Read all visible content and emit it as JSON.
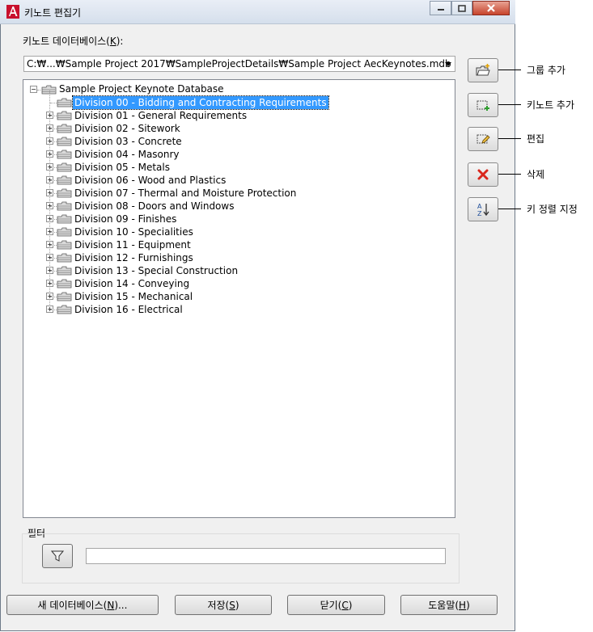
{
  "window": {
    "title": "키노트 편집기",
    "controls": {
      "minimize": "─",
      "maximize": "□",
      "close": "X"
    }
  },
  "database": {
    "label": "키노트 데이터베이스(",
    "label_key": "K",
    "label_end": "):",
    "path": "C:₩...₩Sample Project 2017₩SampleProjectDetails₩Sample Project AecKeynotes.mdb"
  },
  "tree": {
    "root": {
      "label": "Sample Project Keynote Database",
      "expander": "−"
    },
    "items": [
      {
        "label": "Division 00 - Bidding and Contracting Requirements",
        "selected": true,
        "has_children": false
      },
      {
        "label": "Division 01 - General Requirements",
        "has_children": true
      },
      {
        "label": "Division 02 - Sitework",
        "has_children": true
      },
      {
        "label": "Division 03 - Concrete",
        "has_children": true
      },
      {
        "label": "Division 04 - Masonry",
        "has_children": true
      },
      {
        "label": "Division 05 - Metals",
        "has_children": true
      },
      {
        "label": "Division 06 - Wood and Plastics",
        "has_children": true
      },
      {
        "label": "Division 07 - Thermal and Moisture Protection",
        "has_children": true
      },
      {
        "label": "Division 08 - Doors and Windows",
        "has_children": true
      },
      {
        "label": "Division 09 - Finishes",
        "has_children": true
      },
      {
        "label": "Division 10 - Specialities",
        "has_children": true
      },
      {
        "label": "Division 11 - Equipment",
        "has_children": true
      },
      {
        "label": "Division 12 - Furnishings",
        "has_children": true
      },
      {
        "label": "Division 13 - Special Construction",
        "has_children": true
      },
      {
        "label": "Division 14 - Conveying",
        "has_children": true
      },
      {
        "label": "Division 15 - Mechanical",
        "has_children": true
      },
      {
        "label": "Division 16 - Electrical",
        "has_children": true
      }
    ]
  },
  "side_buttons": [
    {
      "icon": "add-group-icon",
      "callout": "그룹 추가"
    },
    {
      "icon": "add-keynote-icon",
      "callout": "키노트 추가"
    },
    {
      "icon": "edit-icon",
      "callout": "편집"
    },
    {
      "icon": "delete-icon",
      "callout": "삭제"
    },
    {
      "icon": "sort-icon",
      "callout": "키 정렬 지정"
    }
  ],
  "filter": {
    "label": "필터",
    "icon": "filter-icon",
    "value": ""
  },
  "buttons": {
    "new_db": {
      "label": "새 데이터베이스(",
      "key": "N",
      "end": ")..."
    },
    "save": {
      "label": "저장(",
      "key": "S",
      "end": ")"
    },
    "close": {
      "label": "닫기(",
      "key": "C",
      "end": ")"
    },
    "help": {
      "label": "도움말(",
      "key": "H",
      "end": ")"
    }
  },
  "colors": {
    "selection": "#3399ff",
    "delete_icon": "#d9261c",
    "add_icon": "#2e9e2e"
  }
}
